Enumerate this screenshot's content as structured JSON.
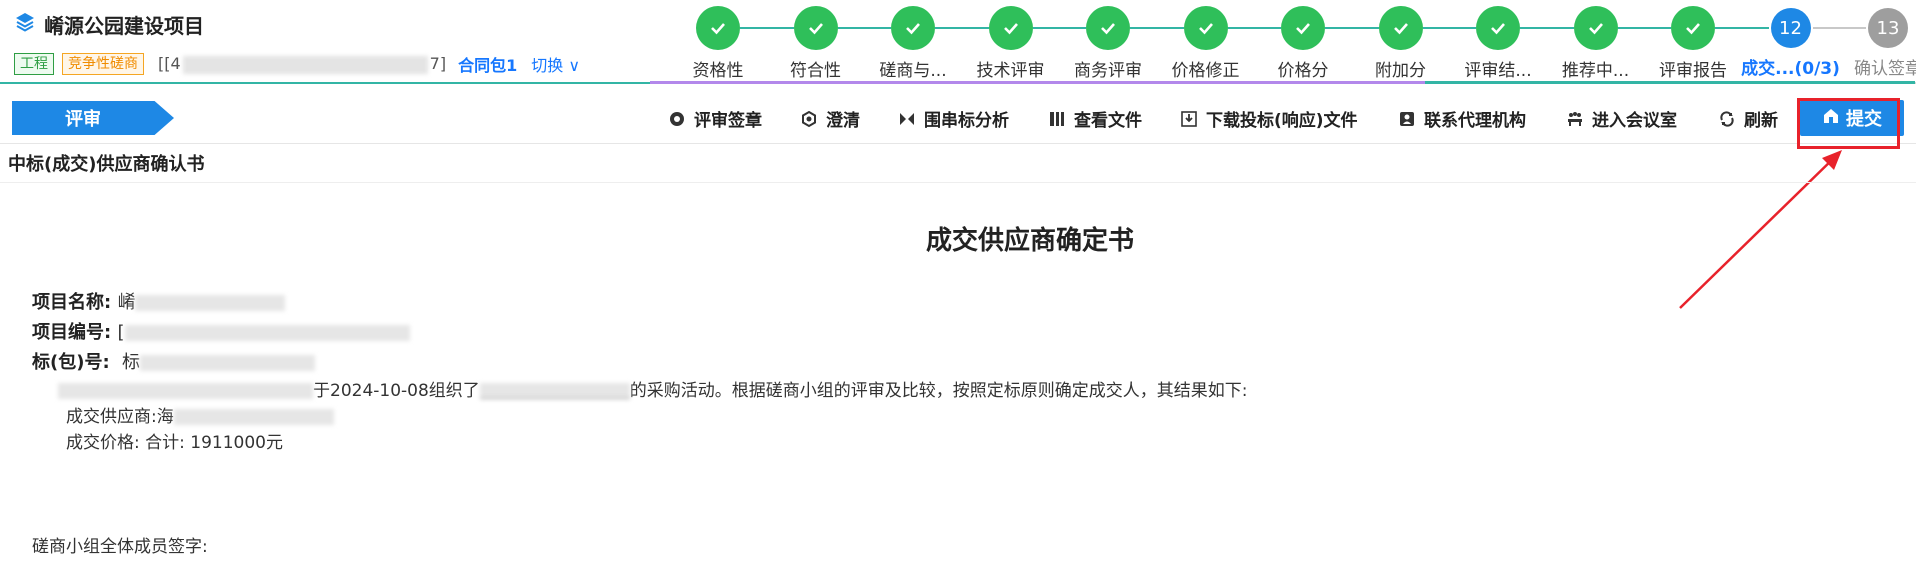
{
  "header": {
    "project_title": "崤源公园建设项目",
    "tag_engineering": "工程",
    "tag_negotiation": "竞争性磋商",
    "project_id_prefix": "[[4",
    "project_id_suffix": "7]",
    "package": "合同包1",
    "switch_label": "切换"
  },
  "steps": [
    {
      "num": "",
      "label": "资格性",
      "status": "done"
    },
    {
      "num": "",
      "label": "符合性",
      "status": "done"
    },
    {
      "num": "",
      "label": "磋商与...",
      "status": "done"
    },
    {
      "num": "",
      "label": "技术评审",
      "status": "done"
    },
    {
      "num": "",
      "label": "商务评审",
      "status": "done"
    },
    {
      "num": "",
      "label": "价格修正",
      "status": "done"
    },
    {
      "num": "",
      "label": "价格分",
      "status": "done"
    },
    {
      "num": "",
      "label": "附加分",
      "status": "done"
    },
    {
      "num": "",
      "label": "评审结...",
      "status": "done"
    },
    {
      "num": "",
      "label": "推荐中...",
      "status": "done"
    },
    {
      "num": "",
      "label": "评审报告",
      "status": "done"
    },
    {
      "num": "12",
      "label": "成交...(0/3)",
      "status": "active"
    },
    {
      "num": "13",
      "label": "确认签章",
      "status": "todo"
    }
  ],
  "toolbar": {
    "review_tag": "评审",
    "buttons": [
      {
        "label": "评审签章",
        "icon": "seal-icon"
      },
      {
        "label": "澄清",
        "icon": "clarify-icon"
      },
      {
        "label": "围串标分析",
        "icon": "analysis-icon"
      },
      {
        "label": "查看文件",
        "icon": "files-icon"
      },
      {
        "label": "下载投标(响应)文件",
        "icon": "download-icon"
      },
      {
        "label": "联系代理机构",
        "icon": "contact-icon"
      },
      {
        "label": "进入会议室",
        "icon": "meeting-icon"
      },
      {
        "label": "刷新",
        "icon": "refresh-icon"
      }
    ],
    "submit_label": "提交"
  },
  "document": {
    "section_title": "中标(成交)供应商确认书",
    "title": "成交供应商确定书",
    "project_name_label": "项目名称:",
    "project_name_value": "崤",
    "project_code_label": "项目编号:",
    "project_code_value": "[",
    "package_label": "标(包)号:",
    "package_value": "标",
    "body_text_after": "于2024-10-08组织了",
    "body_text_end": "的采购活动。根据磋商小组的评审及比较，按照定标原则确定成交人，其结果如下:",
    "supplier_label": "成交供应商:",
    "supplier_value": "海",
    "price_label": "成交价格:",
    "price_value": "合计: 1911000元",
    "sign_label": "磋商小组全体成员签字:"
  }
}
